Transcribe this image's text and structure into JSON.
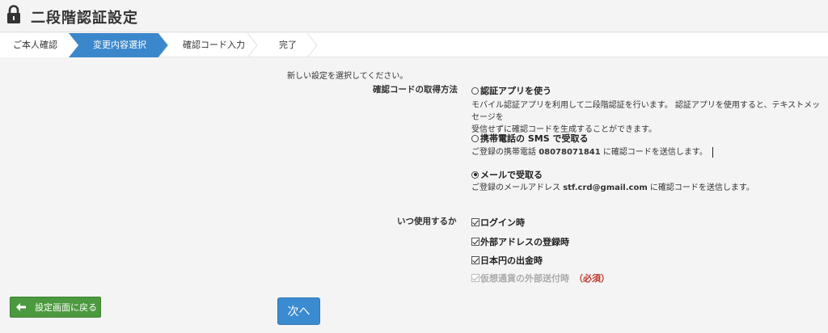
{
  "header": {
    "title": "二段階認証設定",
    "icon": "lock-icon"
  },
  "steps": [
    {
      "label": "ご本人確認",
      "state": "done"
    },
    {
      "label": "変更内容選択",
      "state": "active"
    },
    {
      "label": "確認コード入力",
      "state": "todo"
    },
    {
      "label": "完了",
      "state": "todo"
    }
  ],
  "intro": "新しい設定を選択してください。",
  "method": {
    "label": "確認コードの取得方法",
    "options": [
      {
        "label": "認証アプリを使う",
        "selected": false,
        "desc_line1": "モバイル認証アプリを利用して二段階認証を行います。 認証アプリを使用すると、テキストメッセージを",
        "desc_line2": "受信せずに確認コードを生成することができます。"
      },
      {
        "label": "携帯電話の SMS で受取る",
        "selected": false,
        "desc_prefix": "ご登録の携帯電話 ",
        "desc_value": "08078071841",
        "desc_suffix": " に確認コードを送信します。"
      },
      {
        "label": "メールで受取る",
        "selected": true,
        "desc_prefix": "ご登録のメールアドレス ",
        "desc_value": "stf.crd@gmail.com",
        "desc_suffix": " に確認コードを送信します。"
      }
    ]
  },
  "usage": {
    "label": "いつ使用するか",
    "options": [
      {
        "label": "ログイン時",
        "checked": true,
        "disabled": false
      },
      {
        "label": "外部アドレスの登録時",
        "checked": true,
        "disabled": false
      },
      {
        "label": "日本円の出金時",
        "checked": true,
        "disabled": false
      },
      {
        "label": "仮想通貨の外部送付時",
        "checked": true,
        "disabled": true,
        "note": "（必須）"
      }
    ]
  },
  "buttons": {
    "back": "設定画面に戻る",
    "next": "次へ"
  },
  "colors": {
    "active_step": "#3a87cc",
    "back_button": "#4c9a3f",
    "next_button": "#3b8bd0",
    "required": "#c0392b"
  }
}
